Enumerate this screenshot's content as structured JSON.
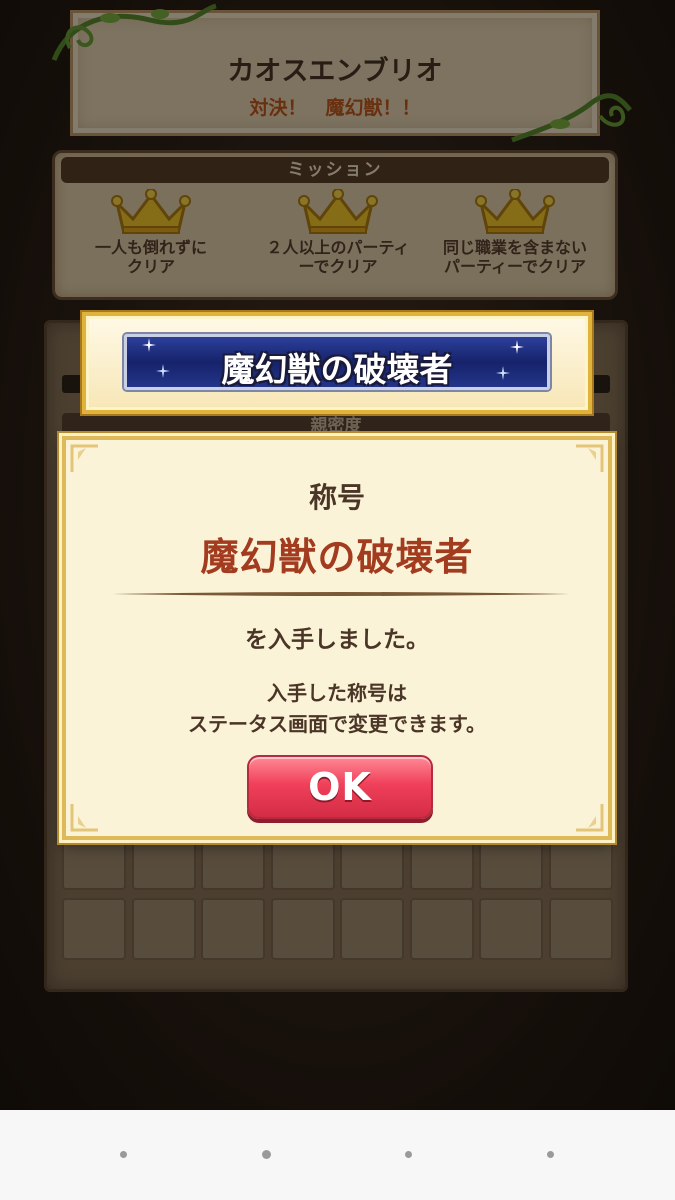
{
  "header": {
    "title": "カオスエンブリオ",
    "subtitle": "対決！　魔幻獣！！"
  },
  "mission": {
    "heading": "ミッション",
    "items": [
      {
        "line1": "一人も倒れずに",
        "line2": "クリア",
        "icon": "crown-icon"
      },
      {
        "line1": "２人以上のパーティ",
        "line2": "ーでクリア",
        "icon": "crown-icon"
      },
      {
        "line1": "同じ職業を含まない",
        "line2": "パーティーでクリア",
        "icon": "crown-icon"
      }
    ]
  },
  "background_panel": {
    "tab_label": "親密度"
  },
  "title_plate": {
    "text": "魔幻獣の破壊者"
  },
  "dialog": {
    "label": "称号",
    "title_name": "魔幻獣の破壊者",
    "obtained_msg": "を入手しました。",
    "info_line1": "入手した称号は",
    "info_line2": "ステータス画面で変更できます。",
    "ok_label": "OK"
  },
  "colors": {
    "accent_red": "#a33b1f",
    "ok_button": "#f0405a",
    "plate_blue": "#16236b",
    "gold": "#e0b43c"
  }
}
